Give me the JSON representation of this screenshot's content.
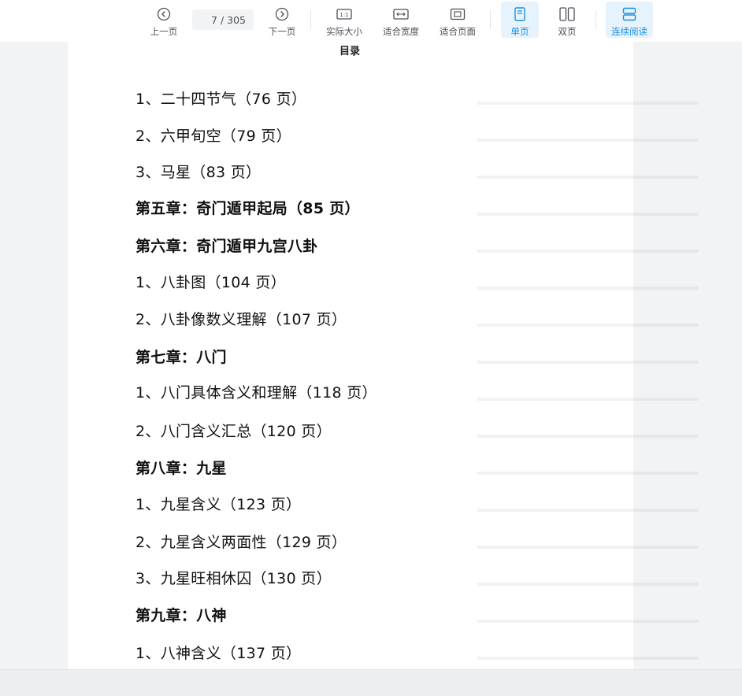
{
  "toolbar": {
    "prev_label": "上一页",
    "next_label": "下一页",
    "current_page": "7",
    "page_total": "/ 305",
    "actual_size_label": "实际大小",
    "fit_width_label": "适合宽度",
    "fit_page_label": "适合页面",
    "single_page_label": "单页",
    "double_page_label": "双页",
    "continuous_label": "连续阅读",
    "active_color": "#1e8fe0"
  },
  "document": {
    "heading": "目录",
    "entries": [
      {
        "text": "1、二十四节气（76 页）",
        "bold": false
      },
      {
        "text": "2、六甲旬空（79 页）",
        "bold": false
      },
      {
        "text": "3、马星（83 页）",
        "bold": false
      },
      {
        "text": "第五章：奇门遁甲起局（85 页）",
        "bold": true
      },
      {
        "text": "第六章：奇门遁甲九宫八卦",
        "bold": true
      },
      {
        "text": "1、八卦图（104 页）",
        "bold": false
      },
      {
        "text": "2、八卦像数义理解（107 页）",
        "bold": false
      },
      {
        "text": "第七章：八门",
        "bold": true
      },
      {
        "text": "1、八门具体含义和理解（118 页）",
        "bold": false
      },
      {
        "text": "2、八门含义汇总（120 页）",
        "bold": false
      },
      {
        "text": "第八章：九星",
        "bold": true
      },
      {
        "text": "1、九星含义（123 页）",
        "bold": false
      },
      {
        "text": "2、九星含义两面性（129 页）",
        "bold": false
      },
      {
        "text": "3、九星旺相休囚（130 页）",
        "bold": false
      },
      {
        "text": "第九章：八神",
        "bold": true
      },
      {
        "text": "1、八神含义（137 页）",
        "bold": false
      }
    ]
  }
}
